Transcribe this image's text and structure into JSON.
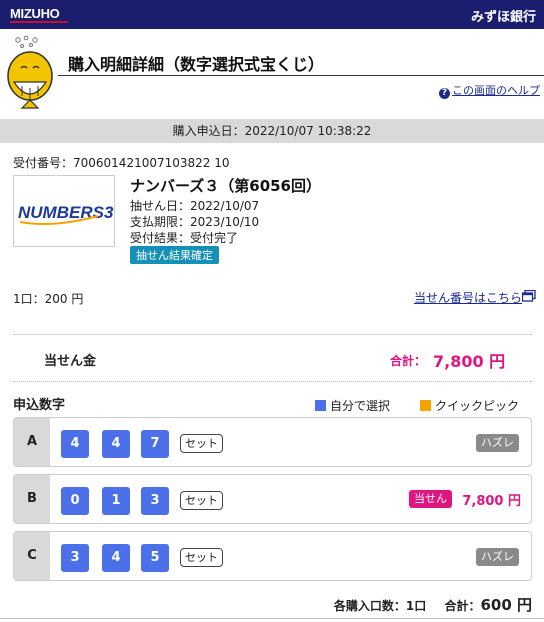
{
  "header": {
    "logo": "MIZUHO",
    "bank_name": "みずほ銀行"
  },
  "page": {
    "title": "購入明細詳細（数字選択式宝くじ）",
    "help_link": "この画面のヘルプ"
  },
  "purchase": {
    "application_date": "購入申込日：2022/10/07 10:38:22",
    "receipt_number": "受付番号：700601421007103822 10"
  },
  "product": {
    "logo_text": "NUMBERS3",
    "title": "ナンバーズ３（第6056回）",
    "draw_date": "抽せん日：2022/10/07",
    "payment_deadline": "支払期限：2023/10/10",
    "acceptance_result": "受付結果：受付完了",
    "status_badge": "抽せん結果確定"
  },
  "summary": {
    "units": "1口：200 円",
    "winning_numbers_link": "当せん番号はこちら",
    "prize_label": "当せん金",
    "prize_total_label": "合計：",
    "prize_total_value": "7,800 円"
  },
  "selection": {
    "title": "申込数字",
    "legend_self": "自分で選択",
    "legend_quick": "クイックピック",
    "colors": {
      "self": "#4b70ea",
      "quick": "#f5a300",
      "win": "#e0157f",
      "lose": "#8a8a8a"
    },
    "rows": [
      {
        "label": "A",
        "numbers": [
          "4",
          "4",
          "7"
        ],
        "type": "セット",
        "result": "ハズレ",
        "amount": ""
      },
      {
        "label": "B",
        "numbers": [
          "0",
          "1",
          "3"
        ],
        "type": "セット",
        "result": "当せん",
        "amount": "7,800 円"
      },
      {
        "label": "C",
        "numbers": [
          "3",
          "4",
          "5"
        ],
        "type": "セット",
        "result": "ハズレ",
        "amount": ""
      }
    ]
  },
  "footer": {
    "units_label": "各購入口数：1口",
    "total_label": "合計：",
    "total_value": "600 円"
  }
}
